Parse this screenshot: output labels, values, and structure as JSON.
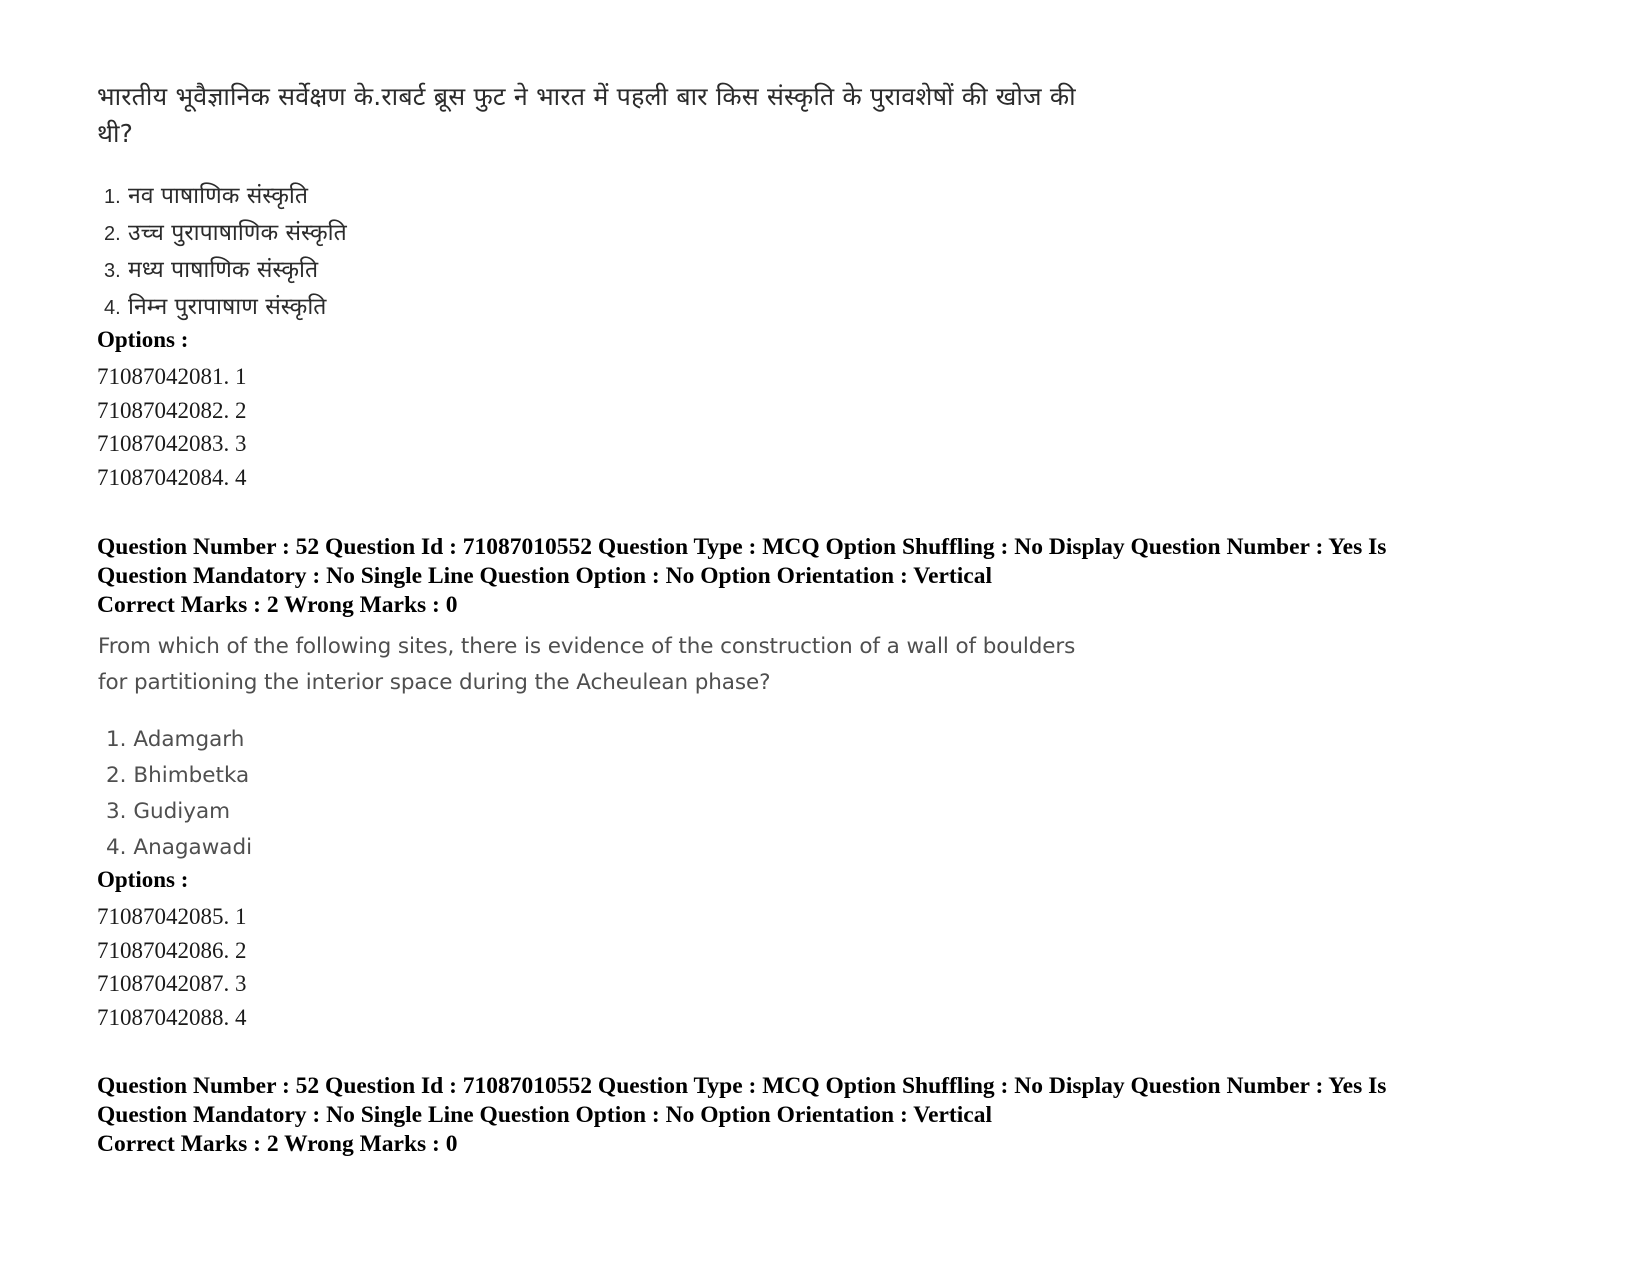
{
  "document": {
    "type": "exam-question-paper-scan",
    "page_background": "#ffffff",
    "text_color": "#000000"
  },
  "question_hindi": {
    "text": "भारतीय भूवैज्ञानिक सर्वेक्षण  के.राबर्ट ब्रूस फुट ने भारत में पहली बार किस संस्कृति के पुरावशेषों की खोज की थी?",
    "options": [
      {
        "num": "1.",
        "text": "नव पाषाणिक संस्कृति"
      },
      {
        "num": "2.",
        "text": "उच्च पुरापाषाणिक संस्कृति"
      },
      {
        "num": "3.",
        "text": "मध्य पाषाणिक संस्कृति"
      },
      {
        "num": "4.",
        "text": "निम्न पुरापाषाण संस्कृति"
      }
    ],
    "options_label": "Options :",
    "option_ids": [
      "71087042081. 1",
      "71087042082. 2",
      "71087042083. 3",
      "71087042084. 4"
    ]
  },
  "meta_block_1": {
    "line1": "Question Number : 52 Question Id : 71087010552 Question Type : MCQ Option Shuffling : No Display Question Number : Yes Is",
    "line2": "Question Mandatory : No Single Line Question Option : No Option Orientation : Vertical",
    "line3": "Correct Marks : 2 Wrong Marks : 0"
  },
  "question_english": {
    "text_line1": "From which of the following sites, there is evidence of the construction of a wall of boulders",
    "text_line2": "for partitioning the interior space during the Acheulean phase?",
    "options": [
      {
        "num": "1.",
        "text": "Adamgarh"
      },
      {
        "num": "2.",
        "text": "Bhimbetka"
      },
      {
        "num": "3.",
        "text": "Gudiyam"
      },
      {
        "num": "4.",
        "text": "Anagawadi"
      }
    ],
    "options_label": "Options :",
    "option_ids": [
      "71087042085. 1",
      "71087042086. 2",
      "71087042087. 3",
      "71087042088. 4"
    ]
  },
  "meta_block_2": {
    "line1": "Question Number : 52 Question Id : 71087010552 Question Type : MCQ Option Shuffling : No Display Question Number : Yes Is",
    "line2": "Question Mandatory : No Single Line Question Option : No Option Orientation : Vertical",
    "line3": "Correct Marks : 2 Wrong Marks : 0"
  }
}
